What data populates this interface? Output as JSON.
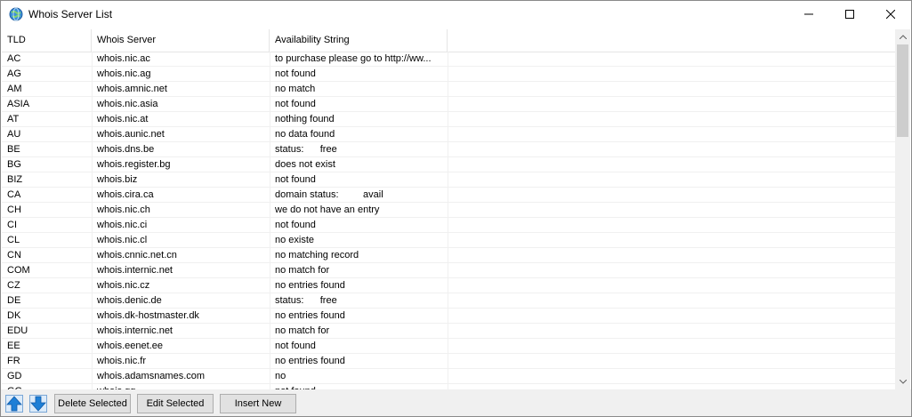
{
  "window": {
    "title": "Whois Server List",
    "icon": "globe-icon",
    "controls": [
      "minimize-icon",
      "maximize-icon",
      "close-icon"
    ]
  },
  "columns": [
    "TLD",
    "Whois Server",
    "Availability String"
  ],
  "rows": [
    [
      "AC",
      "whois.nic.ac",
      "to purchase please go to http://ww..."
    ],
    [
      "AG",
      "whois.nic.ag",
      "not found"
    ],
    [
      "AM",
      "whois.amnic.net",
      "no match"
    ],
    [
      "ASIA",
      "whois.nic.asia",
      "not found"
    ],
    [
      "AT",
      "whois.nic.at",
      "nothing found"
    ],
    [
      "AU",
      "whois.aunic.net",
      "no data found"
    ],
    [
      "BE",
      "whois.dns.be",
      "status:      free"
    ],
    [
      "BG",
      "whois.register.bg",
      "does not exist"
    ],
    [
      "BIZ",
      "whois.biz",
      "not found"
    ],
    [
      "CA",
      "whois.cira.ca",
      "domain status:         avail"
    ],
    [
      "CH",
      "whois.nic.ch",
      "we do not have an entry"
    ],
    [
      "CI",
      "whois.nic.ci",
      "not found"
    ],
    [
      "CL",
      "whois.nic.cl",
      "no existe"
    ],
    [
      "CN",
      "whois.cnnic.net.cn",
      "no matching record"
    ],
    [
      "COM",
      "whois.internic.net",
      "no match for"
    ],
    [
      "CZ",
      "whois.nic.cz",
      "no entries found"
    ],
    [
      "DE",
      "whois.denic.de",
      "status:      free"
    ],
    [
      "DK",
      "whois.dk-hostmaster.dk",
      "no entries found"
    ],
    [
      "EDU",
      "whois.internic.net",
      "no match for"
    ],
    [
      "EE",
      "whois.eenet.ee",
      "not found"
    ],
    [
      "FR",
      "whois.nic.fr",
      "no entries found"
    ],
    [
      "GD",
      "whois.adamsnames.com",
      "no"
    ],
    [
      "GG",
      "whois.gg",
      "not found"
    ]
  ],
  "toolbar": {
    "up_icon": "arrow-up-icon",
    "down_icon": "arrow-down-icon",
    "delete_label": "Delete Selected",
    "edit_label": "Edit Selected",
    "insert_label": "Insert New"
  },
  "colors": {
    "arrow_blue": "#1e7fd6",
    "header_border": "#e5e5e5",
    "toolbar_bg": "#f0f0f0"
  }
}
